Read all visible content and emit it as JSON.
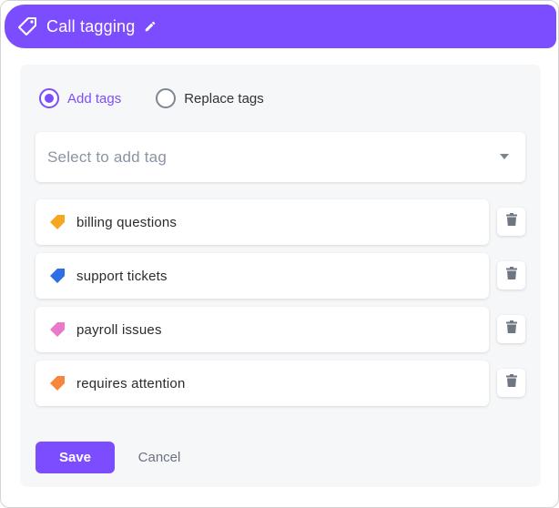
{
  "header": {
    "title": "Call tagging",
    "icon": "tag-icon",
    "edit_icon": "pencil-icon",
    "background": "#7c4dff"
  },
  "mode": {
    "options": [
      {
        "label": "Add tags",
        "selected": true
      },
      {
        "label": "Replace tags",
        "selected": false
      }
    ]
  },
  "tag_select": {
    "placeholder": "Select to add tag",
    "icon": "chevron-down-icon"
  },
  "tags": [
    {
      "name": "billing questions",
      "color": "#f5a623"
    },
    {
      "name": "support tickets",
      "color": "#2f6fe4"
    },
    {
      "name": "payroll issues",
      "color": "#e879c8"
    },
    {
      "name": "requires attention",
      "color": "#f5863b"
    }
  ],
  "actions": {
    "save_label": "Save",
    "cancel_label": "Cancel"
  },
  "colors": {
    "accent": "#7c4dff",
    "panel_bg": "#f6f7f9"
  }
}
